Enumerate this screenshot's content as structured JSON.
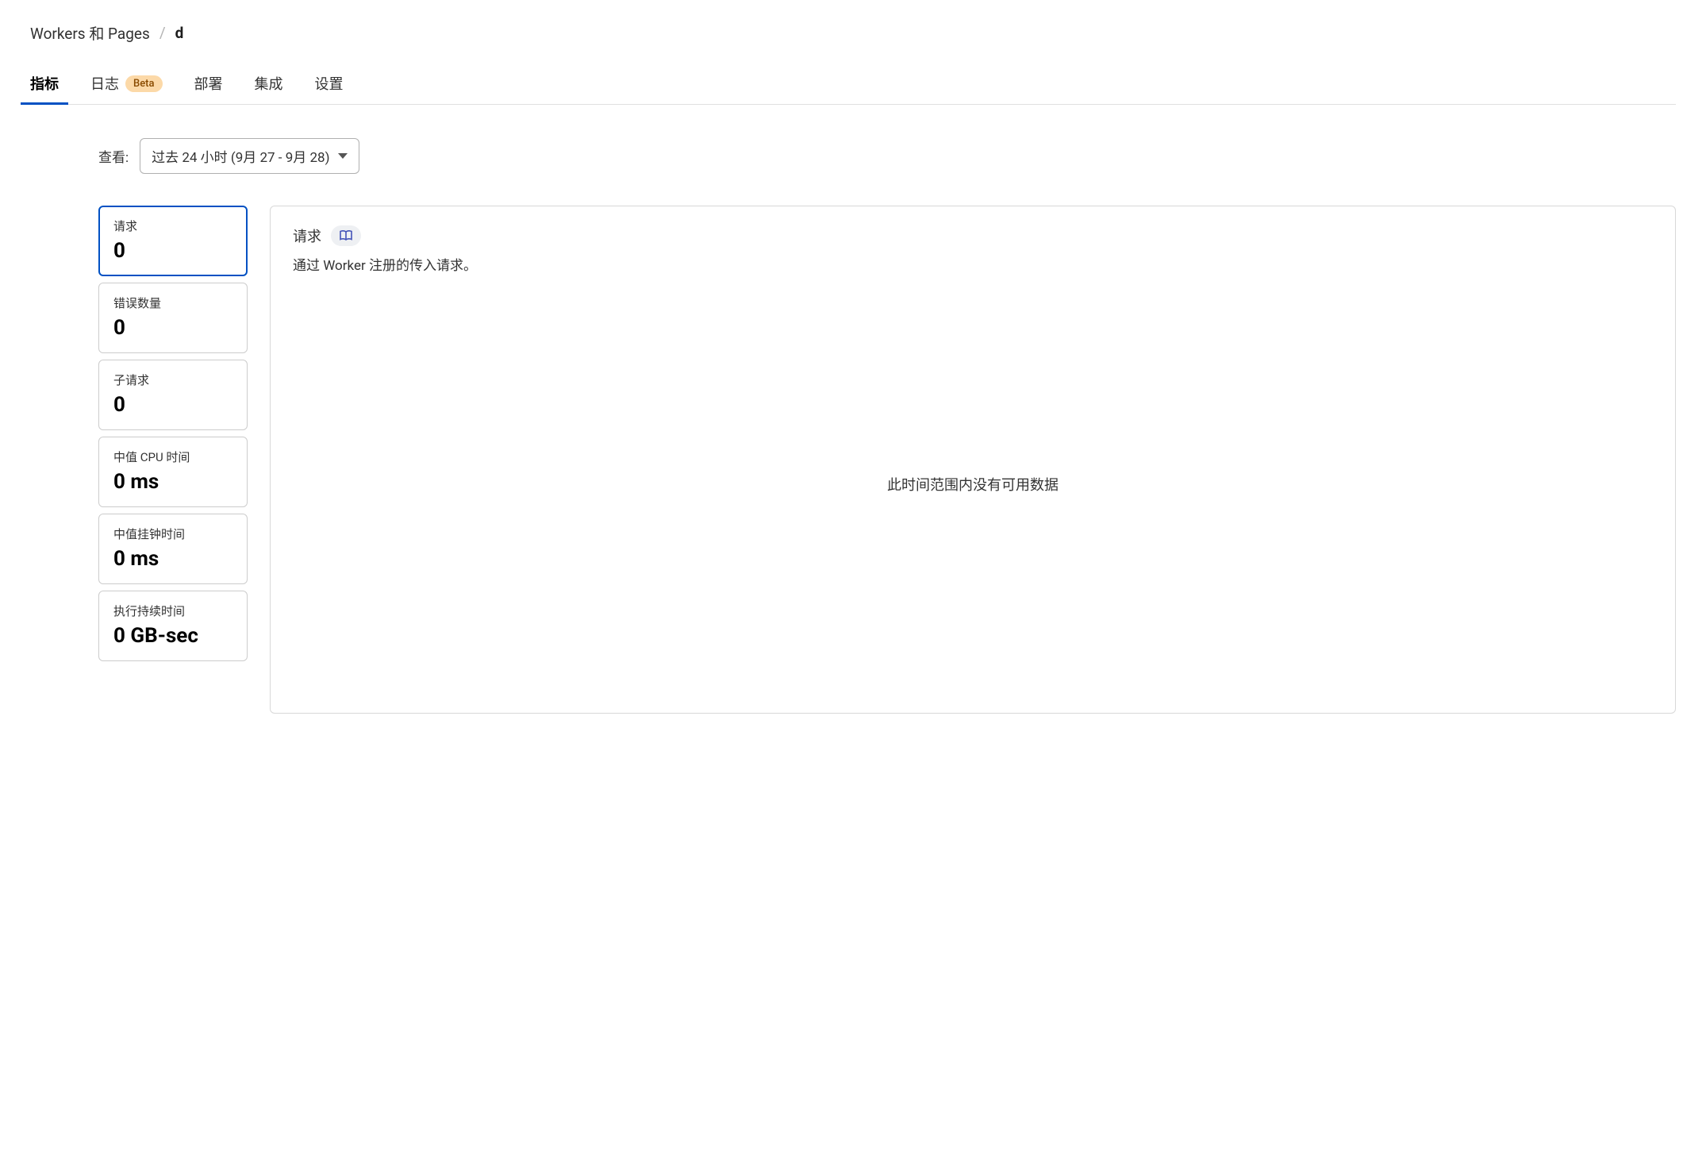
{
  "breadcrumb": {
    "parent": "Workers 和 Pages",
    "separator": "/",
    "current": "d"
  },
  "tabs": {
    "metrics": "指标",
    "logs": "日志",
    "logs_badge": "Beta",
    "deployments": "部署",
    "integrations": "集成",
    "settings": "设置"
  },
  "view": {
    "label": "查看:",
    "range_text": "过去 24 小时 (9月 27 - 9月 28)"
  },
  "metrics": [
    {
      "label": "请求",
      "value": "0"
    },
    {
      "label": "错误数量",
      "value": "0"
    },
    {
      "label": "子请求",
      "value": "0"
    },
    {
      "label": "中值 CPU 时间",
      "value": "0 ms"
    },
    {
      "label": "中值挂钟时间",
      "value": "0 ms"
    },
    {
      "label": "执行持续时间",
      "value": "0 GB-sec"
    }
  ],
  "chart": {
    "title": "请求",
    "subtitle": "通过 Worker 注册的传入请求。",
    "no_data": "此时间范围内没有可用数据"
  }
}
